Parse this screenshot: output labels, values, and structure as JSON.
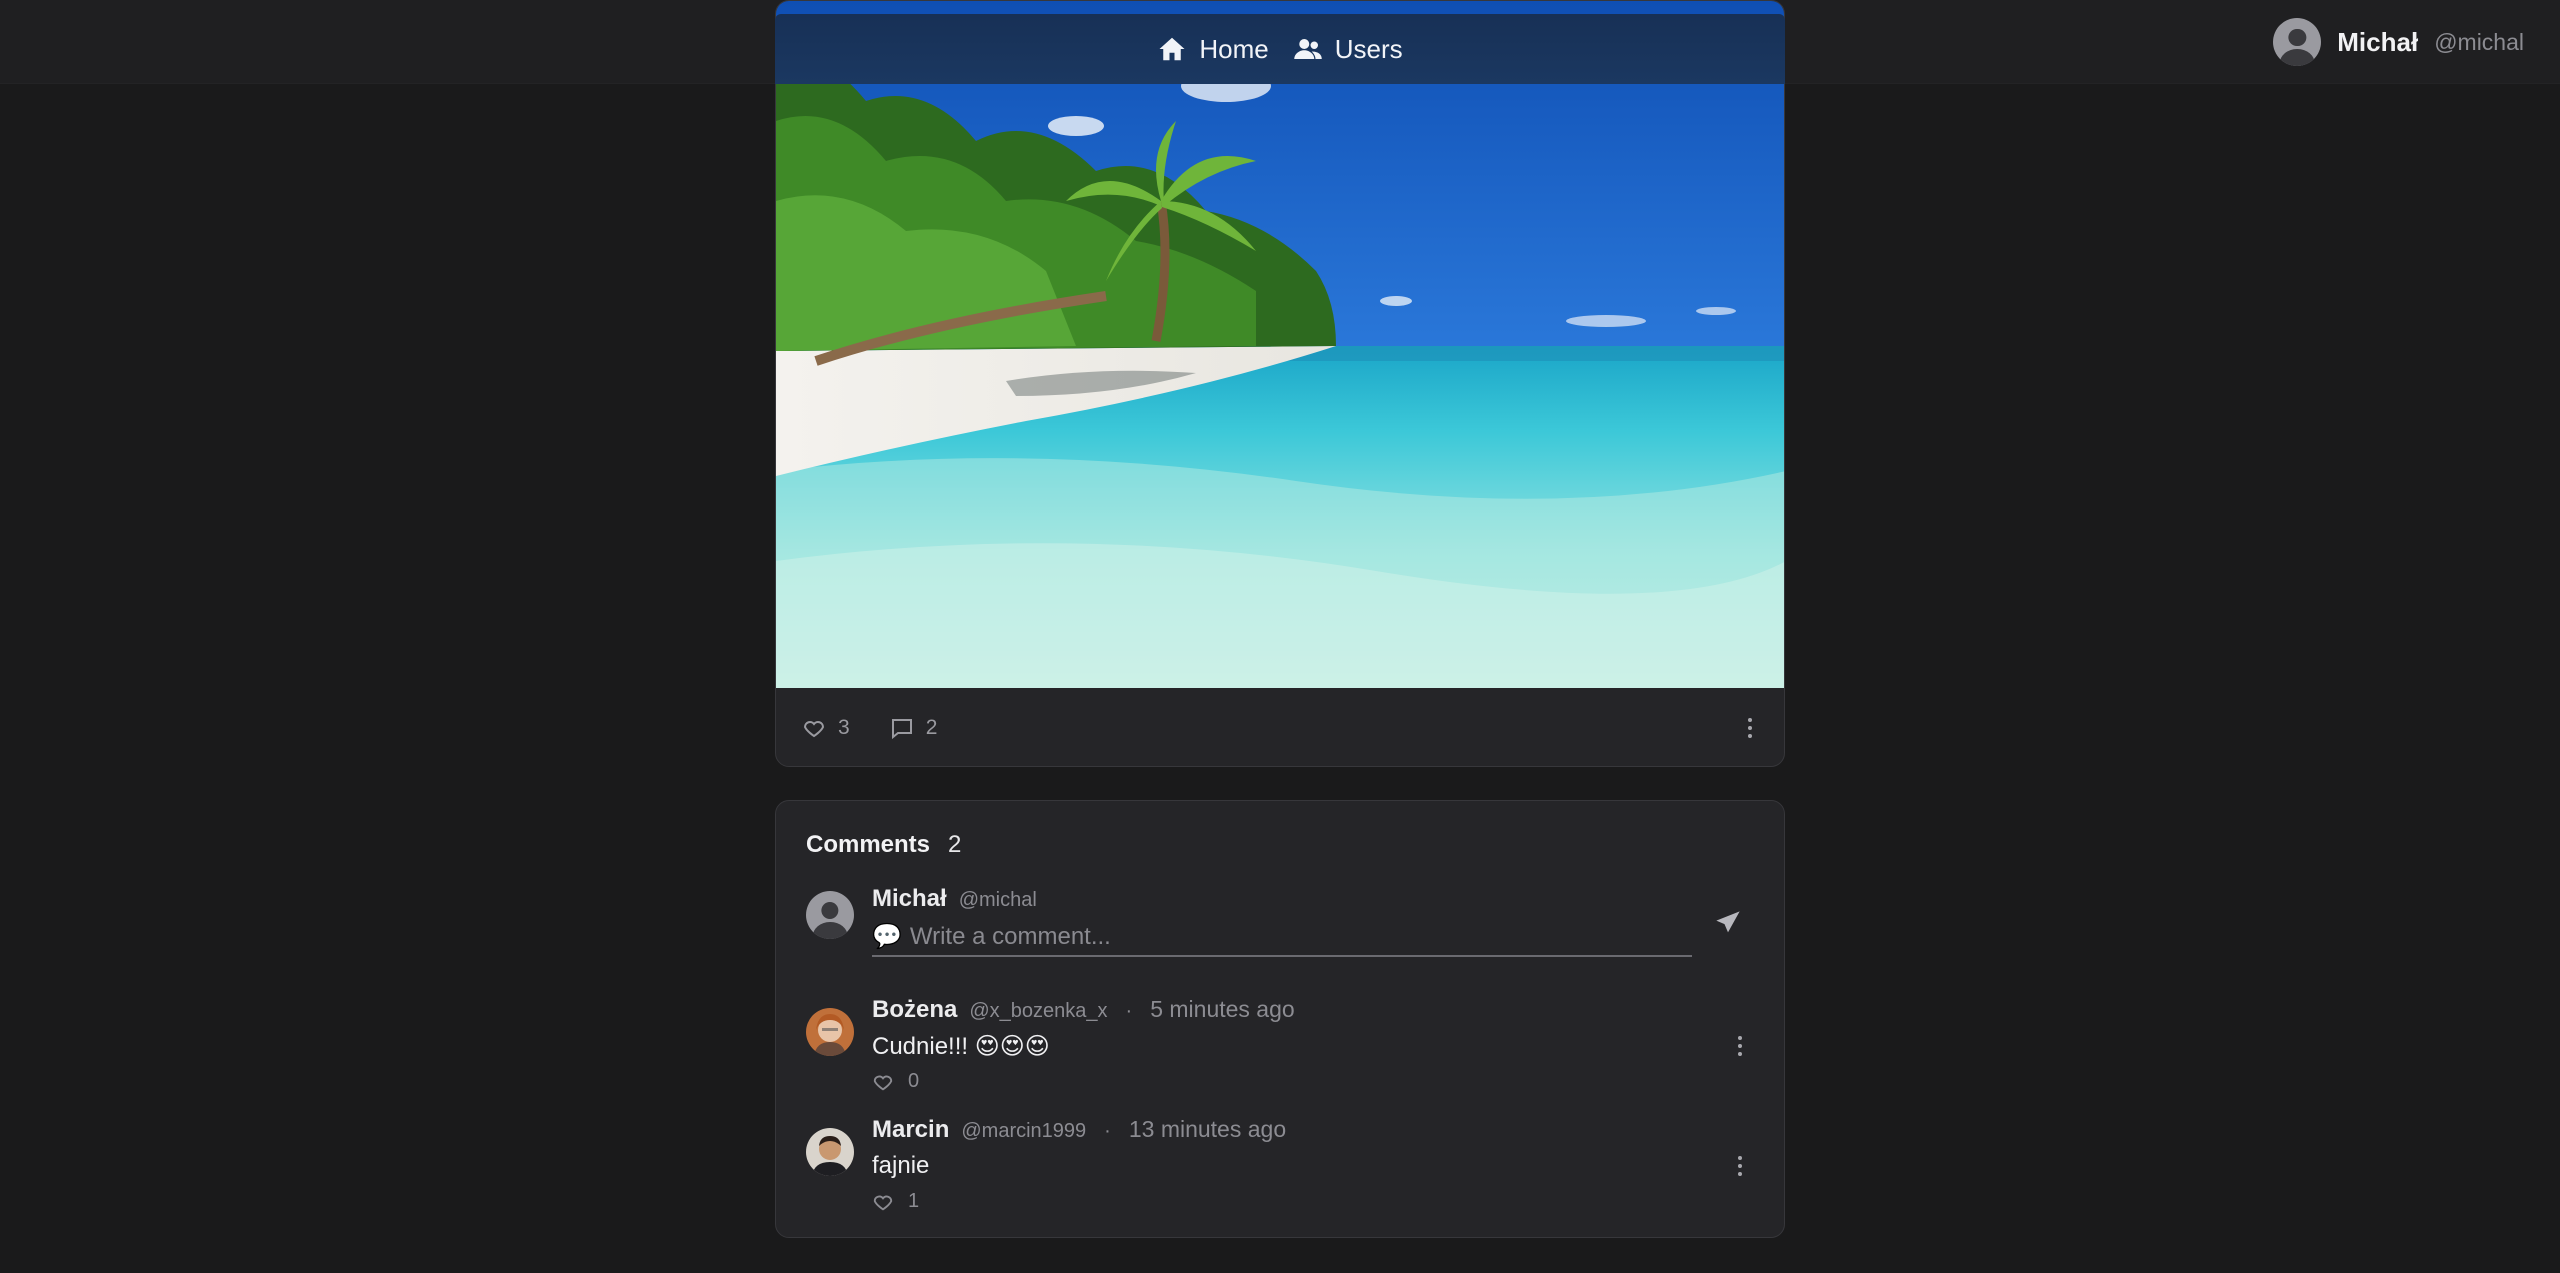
{
  "nav": {
    "home_label": "Home",
    "users_label": "Users"
  },
  "current_user": {
    "name": "Michał",
    "handle": "@michal"
  },
  "post": {
    "image_alt": "beach",
    "likes": "3",
    "comments": "2"
  },
  "comments_section": {
    "title": "Comments",
    "count": "2",
    "composer": {
      "name": "Michał",
      "handle": "@michal",
      "placeholder": "Write a comment..."
    },
    "items": [
      {
        "author": "Bożena",
        "handle": "@x_bozenka_x",
        "separator": "·",
        "time": "5 minutes ago",
        "text": "Cudnie!!! 😍😍😍",
        "likes": "0"
      },
      {
        "author": "Marcin",
        "handle": "@marcin1999",
        "separator": "·",
        "time": "13 minutes ago",
        "text": "fajnie",
        "likes": "1"
      }
    ]
  },
  "colors": {
    "background": "#1a1a1b",
    "card": "#252528",
    "nav_bar": "#173056",
    "accent_icon": "#6fa3d8"
  }
}
